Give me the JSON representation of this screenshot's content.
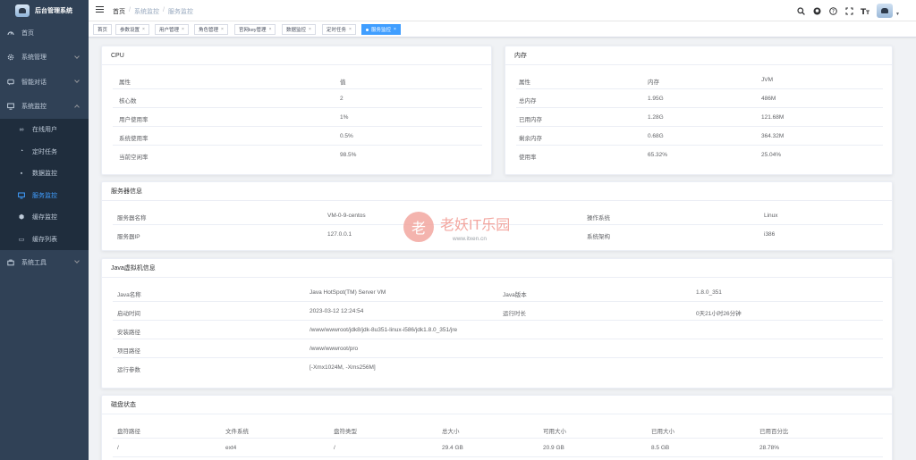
{
  "app": {
    "title": "后台管理系统"
  },
  "sidebar": {
    "items": [
      {
        "label": "首页",
        "icon": "dashboard-icon"
      },
      {
        "label": "系统管理",
        "icon": "gear-icon"
      },
      {
        "label": "智能对话",
        "icon": "chat-icon"
      },
      {
        "label": "系统监控",
        "icon": "monitor-icon"
      },
      {
        "label": "系统工具",
        "icon": "tool-icon"
      }
    ],
    "sub_items": [
      {
        "label": "在线用户",
        "icon": "online-icon"
      },
      {
        "label": "定时任务",
        "icon": "job-icon"
      },
      {
        "label": "数据监控",
        "icon": "data-icon"
      },
      {
        "label": "服务监控",
        "icon": "server-icon"
      },
      {
        "label": "缓存监控",
        "icon": "cache-icon"
      },
      {
        "label": "缓存列表",
        "icon": "list-icon"
      }
    ]
  },
  "breadcrumb": [
    "首页",
    "系统监控",
    "服务监控"
  ],
  "tags": [
    "首页",
    "参数设置",
    "用户管理",
    "角色管理",
    "官网key管理",
    "数据监控",
    "定时任务",
    "服务监控"
  ],
  "cpu": {
    "title": "CPU",
    "headers": [
      "属性",
      "值"
    ],
    "rows": [
      [
        "核心数",
        "2"
      ],
      [
        "用户使用率",
        "1%"
      ],
      [
        "系统使用率",
        "0.5%"
      ],
      [
        "当前空闲率",
        "98.5%"
      ]
    ]
  },
  "memory": {
    "title": "内存",
    "headers": [
      "属性",
      "内存",
      "JVM"
    ],
    "rows": [
      [
        "总内存",
        "1.95G",
        "486M"
      ],
      [
        "已用内存",
        "1.28G",
        "121.68M"
      ],
      [
        "剩余内存",
        "0.68G",
        "364.32M"
      ],
      [
        "使用率",
        "65.32%",
        "25.04%"
      ]
    ]
  },
  "server": {
    "title": "服务器信息",
    "rows": [
      [
        "服务器名称",
        "VM-0-9-centos",
        "操作系统",
        "Linux"
      ],
      [
        "服务器IP",
        "127.0.0.1",
        "系统架构",
        "i386"
      ]
    ]
  },
  "jvm": {
    "title": "Java虚拟机信息",
    "rows": [
      [
        "Java名称",
        "Java HotSpot(TM) Server VM",
        "Java版本",
        "1.8.0_351"
      ],
      [
        "启动时间",
        "2023-03-12 12:24:54",
        "运行时长",
        "0天21小时26分钟"
      ]
    ],
    "wide_rows": [
      [
        "安装路径",
        "/www/wwwroot/jdk8/jdk-8u351-linux-i586/jdk1.8.0_351/jre"
      ],
      [
        "项目路径",
        "/www/wwwroot/pro"
      ],
      [
        "运行参数",
        "[-Xmx1024M, -Xms256M]"
      ]
    ]
  },
  "disk": {
    "title": "磁盘状态",
    "headers": [
      "盘符路径",
      "文件系统",
      "盘符类型",
      "总大小",
      "可用大小",
      "已用大小",
      "已用百分比"
    ],
    "rows": [
      [
        "/",
        "ext4",
        "/",
        "29.4 GB",
        "20.9 GB",
        "8.5 GB",
        "28.78%"
      ]
    ]
  },
  "watermark": {
    "glyph": "老",
    "title": "老妖IT乐园",
    "url": "www.itxen.cn"
  },
  "nav_icons": [
    "search-icon",
    "github-icon",
    "help-icon",
    "fullscreen-icon",
    "font-size-icon"
  ],
  "colors": {
    "sidebar_bg": "#304156",
    "submenu_bg": "#1f2d3d",
    "accent": "#409eff",
    "menu_text": "#bfcbd9"
  }
}
